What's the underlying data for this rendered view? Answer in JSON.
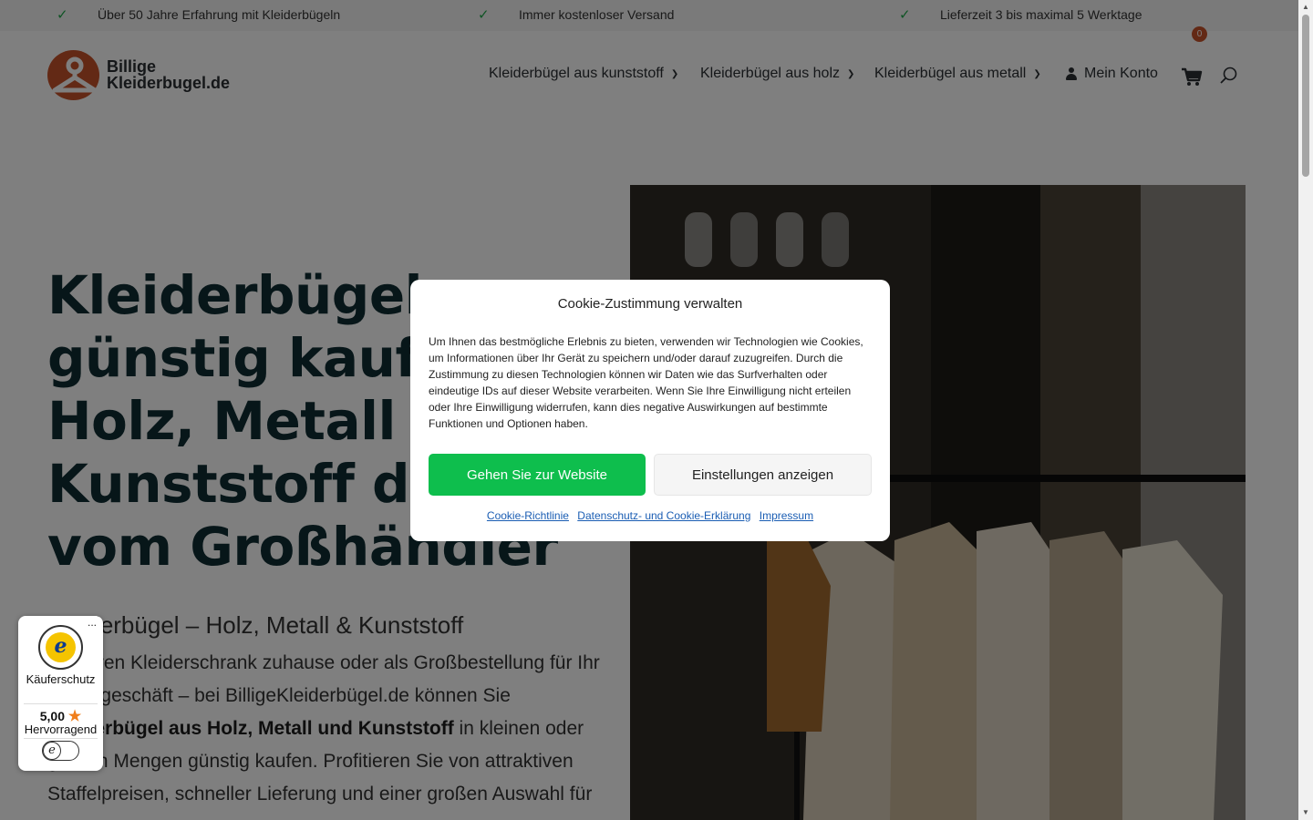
{
  "usp_bar": {
    "items": [
      "Über 50 Jahre Erfahrung mit Kleiderbügeln",
      "Immer kostenloser Versand",
      "Lieferzeit 3 bis maximal 5 Werktage"
    ]
  },
  "header": {
    "logo_line1": "Billige",
    "logo_line2": "Kleiderbugel.de",
    "nav": [
      "Kleiderbügel aus kunststoff",
      "Kleiderbügel aus holz",
      "Kleiderbügel aus metall"
    ],
    "account_label": "Mein Konto",
    "cart_count": "0"
  },
  "hero": {
    "title_lines": [
      "Kleiderbügel",
      "günstig kaufen:",
      "Holz, Metall &",
      "Kunststoff direkt",
      "vom Großhändler"
    ],
    "subtitle": "Kleiderbügel – Holz, Metall & Kunststoff",
    "body_part1": "Für Ihren Kleiderschrank zuhause oder als Großbestellung für Ihr Ladengeschäft – bei BilligeKleiderbügel.de können Sie ",
    "body_bold": "Kleiderbügel aus Holz, Metall und Kunststoff",
    "body_part2": " in kleinen oder großen Mengen günstig kaufen. Profitieren Sie von attraktiven Staffelpreisen, schneller Lieferung und einer großen Auswahl für"
  },
  "cookie_modal": {
    "title": "Cookie-Zustimmung verwalten",
    "text": "Um Ihnen das bestmögliche Erlebnis zu bieten, verwenden wir Technologien wie Cookies, um Informationen über Ihr Gerät zu speichern und/oder darauf zuzugreifen. Durch die Zustimmung zu diesen Technologien können wir Daten wie das Surfverhalten oder eindeutige IDs auf dieser Website verarbeiten. Wenn Sie Ihre Einwilligung nicht erteilen oder Ihre Einwilligung widerrufen, kann dies negative Auswirkungen auf bestimmte Funktionen und Optionen haben.",
    "accept_label": "Gehen Sie zur Website",
    "settings_label": "Einstellungen anzeigen",
    "links": [
      "Cookie-Richtlinie",
      "Datenschutz- und Cookie-Erklärung",
      "Impressum"
    ]
  },
  "trusted_shops": {
    "more": "...",
    "label": "Käuferschutz",
    "score": "5,00",
    "rating": "Hervorragend",
    "seal_letter": "e"
  },
  "colors": {
    "accent_green": "#0ebe4d",
    "brand_orange": "#c6532a",
    "heading": "#0f2d33"
  }
}
